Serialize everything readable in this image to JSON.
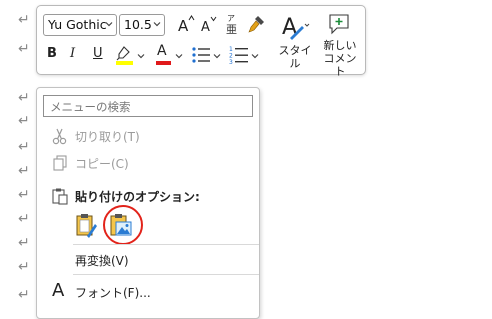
{
  "paragraph_mark": "↵",
  "toolbar": {
    "font_name": "Yu Gothic",
    "font_size": "10.5",
    "bold": "B",
    "italic": "I",
    "underline": "U",
    "font_color": "A",
    "font_color_bar": "#e0191b",
    "highlight_bar": "#ffff00",
    "styles_label": "スタイル",
    "new_comment_line1": "新しい",
    "new_comment_line2": "コメント"
  },
  "menu": {
    "search_placeholder": "メニューの検索",
    "cut_label": "切り取り(T)",
    "copy_label": "コピー(C)",
    "paste_options_label": "貼り付けのオプション:",
    "reconvert_label": "再変換(V)",
    "font_label": "フォント(F)..."
  }
}
